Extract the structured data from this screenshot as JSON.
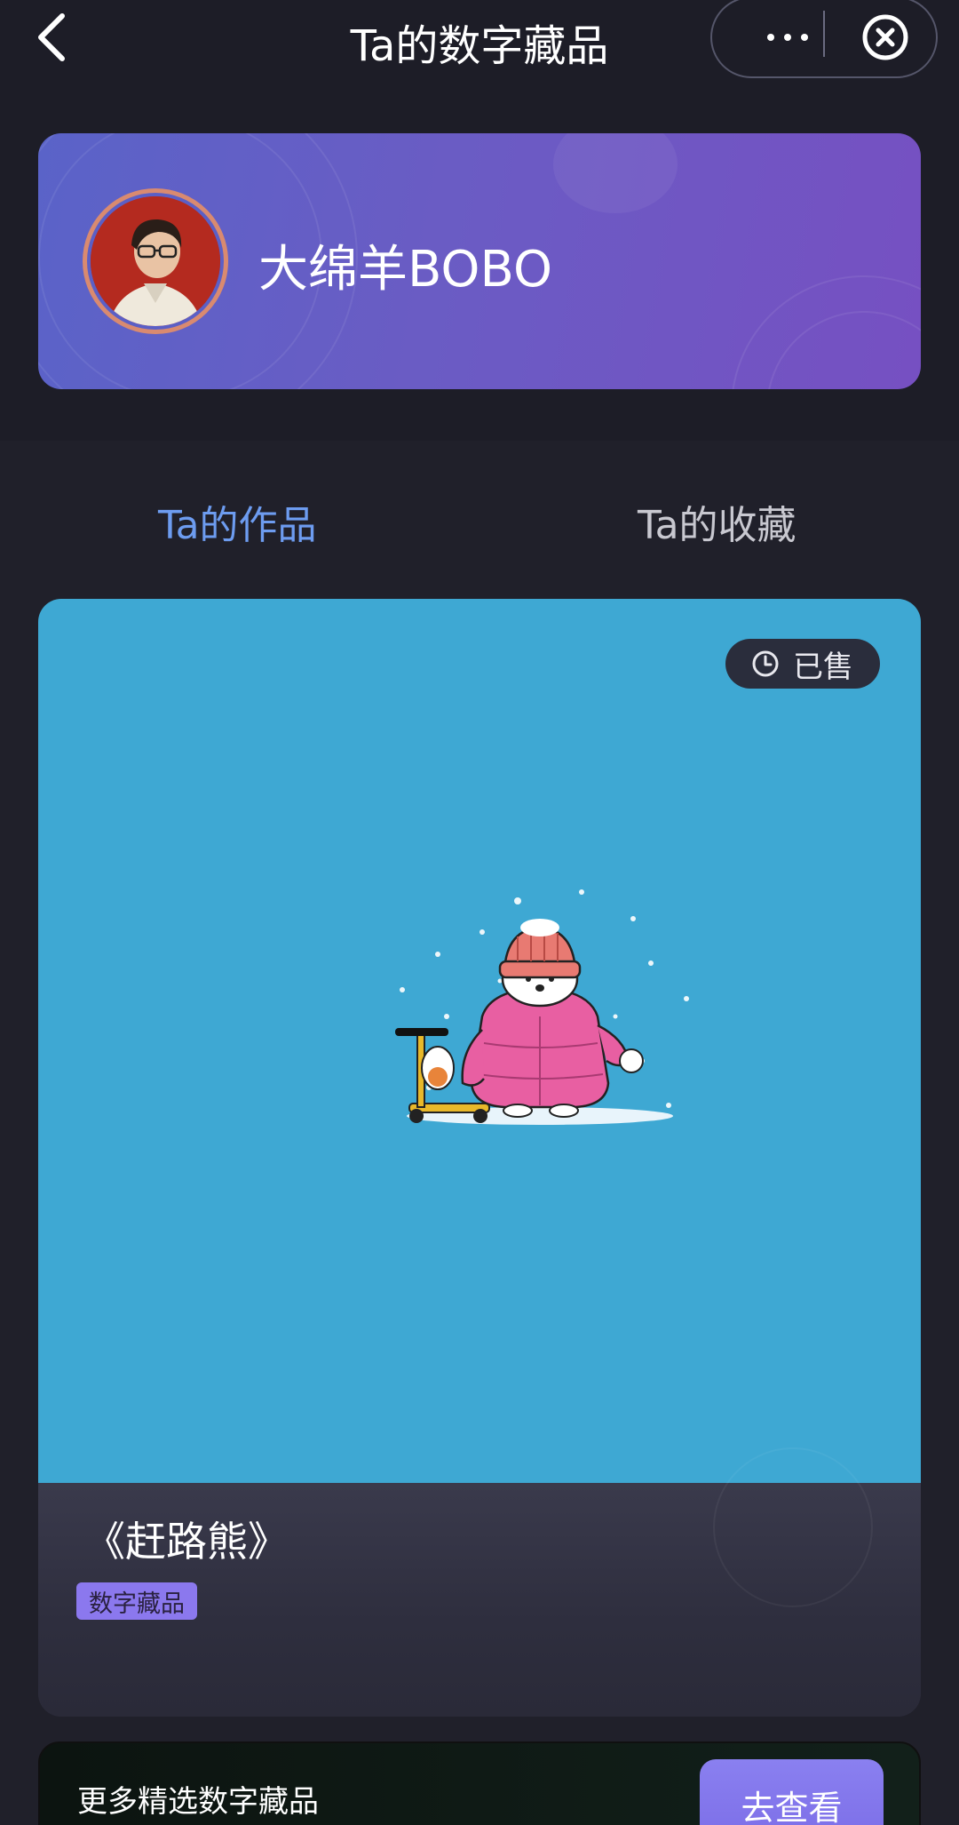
{
  "nav": {
    "title": "Ta的数字藏品",
    "back_icon": "chevron-left-icon",
    "more_icon": "ellipsis-icon",
    "close_icon": "close-circle-icon"
  },
  "profile": {
    "username": "大绵羊BOBO",
    "avatar_icon": "user-avatar"
  },
  "tabs": [
    {
      "label": "Ta的作品",
      "active": true
    },
    {
      "label": "Ta的收藏",
      "active": false
    }
  ],
  "item": {
    "status_label": "已售",
    "status_icon": "clock-icon",
    "title": "《赶路熊》",
    "tag": "数字藏品",
    "image_color": "#3ea8d3"
  },
  "banner": {
    "text": "更多精选数字藏品",
    "button_label": "去查看"
  },
  "colors": {
    "accent": "#6d9cf0",
    "tag": "#8b78ee",
    "background": "#1d1d27"
  }
}
